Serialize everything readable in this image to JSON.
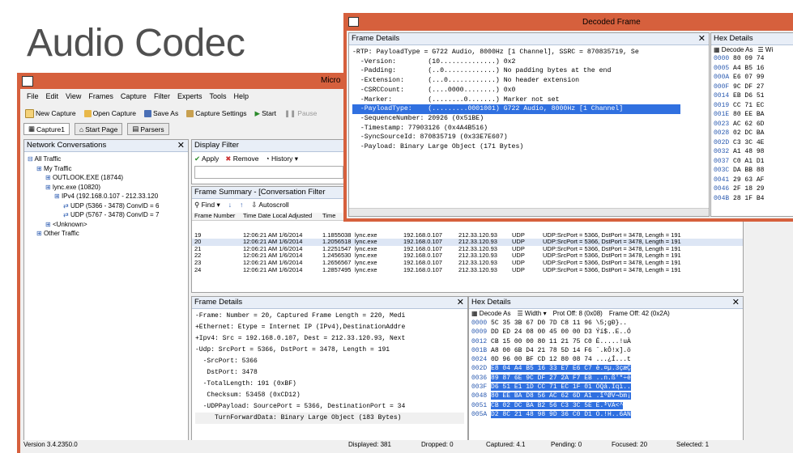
{
  "slide": {
    "title": "Audio Codec"
  },
  "app": {
    "title": "Micro",
    "menu": [
      "File",
      "Edit",
      "View",
      "Frames",
      "Capture",
      "Filter",
      "Experts",
      "Tools",
      "Help"
    ],
    "toolbar": [
      "New Capture",
      "Open Capture",
      "Save As",
      "Capture Settings",
      "Start",
      "Pause"
    ],
    "tabs": [
      "Capture1",
      "Start Page",
      "Parsers"
    ]
  },
  "network_conversations": {
    "title": "Network Conversations",
    "items": [
      {
        "label": "All Traffic",
        "indent": 0
      },
      {
        "label": "My Traffic",
        "indent": 1
      },
      {
        "label": "OUTLOOK.EXE (18744)",
        "indent": 2
      },
      {
        "label": "lync.exe (10820)",
        "indent": 2
      },
      {
        "label": "IPv4 (192.168.0.107 - 212.33.120",
        "indent": 3
      },
      {
        "label": "UDP (5366 - 3478) ConvID = 6",
        "indent": 4
      },
      {
        "label": "UDP (5767 - 3478) ConvID = 7",
        "indent": 4
      },
      {
        "label": "<Unknown>",
        "indent": 2
      },
      {
        "label": "Other Traffic",
        "indent": 1
      }
    ]
  },
  "display_filter": {
    "title": "Display Filter",
    "buttons": [
      "Apply",
      "Remove",
      "History"
    ]
  },
  "frame_summary": {
    "title": "Frame Summary - [Conversation Filter",
    "buttons": [
      "Find",
      "Autoscroll"
    ],
    "columns": [
      "Frame Number",
      "Time Date Local Adjusted",
      "Time"
    ],
    "rows": [
      [
        "19",
        "12:06:21 AM 1/6/2014",
        "1.1855038",
        "lync.exe",
        "192.168.0.107",
        "212.33.120.93",
        "UDP",
        "UDP:SrcPort = 5366, DstPort = 3478, Length = 191"
      ],
      [
        "20",
        "12:06:21 AM 1/6/2014",
        "1.2056518",
        "lync.exe",
        "192.168.0.107",
        "212.33.120.93",
        "UDP",
        "UDP:SrcPort = 5366, DstPort = 3478, Length = 191"
      ],
      [
        "21",
        "12:06:21 AM 1/6/2014",
        "1.2251547",
        "lync.exe",
        "192.168.0.107",
        "212.33.120.93",
        "UDP",
        "UDP:SrcPort = 5366, DstPort = 3478, Length = 191"
      ],
      [
        "22",
        "12:06:21 AM 1/6/2014",
        "1.2456530",
        "lync.exe",
        "192.168.0.107",
        "212.33.120.93",
        "UDP",
        "UDP:SrcPort = 5366, DstPort = 3478, Length = 191"
      ],
      [
        "23",
        "12:06:21 AM 1/6/2014",
        "1.2656567",
        "lync.exe",
        "192.168.0.107",
        "212.33.120.93",
        "UDP",
        "UDP:SrcPort = 5366, DstPort = 3478, Length = 191"
      ],
      [
        "24",
        "12:06:21 AM 1/6/2014",
        "1.2857495",
        "lync.exe",
        "192.168.0.107",
        "212.33.120.93",
        "UDP",
        "UDP:SrcPort = 5366, DstPort = 3478, Length = 191"
      ]
    ]
  },
  "frame_details": {
    "title": "Frame Details",
    "lines": [
      "-Frame: Number = 20, Captured Frame Length = 220, Medi",
      "+Ethernet: Etype = Internet IP (IPv4),DestinationAddre",
      "+Ipv4: Src = 192.168.0.107, Dest = 212.33.120.93, Next",
      "-Udp: SrcPort = 5366, DstPort = 3478, Length = 191",
      "  -SrcPort: 5366",
      "   DstPort: 3478",
      "  -TotalLength: 191 (0xBF)",
      "   Checksum: 53458 (0xCD12)",
      "  -UDPPayload: SourcePort = 5366, DestinationPort = 34",
      "     TurnForwardData: Binary Large Object (183 Bytes)"
    ]
  },
  "hex_details": {
    "title": "Hex Details",
    "buttons": [
      "Decode As",
      "Width",
      "Prot Off: 8 (0x08)",
      "Frame Off: 42 (0x2A)"
    ],
    "rows": [
      [
        "0000",
        "5C 35 3B 67 D0 7D C8 11 96",
        "\\5;gÐ}.."
      ],
      [
        "0009",
        "DD ED 24 08 00 45 00 00 D3",
        "Ýí$..E..Ó"
      ],
      [
        "0012",
        "CB 15 00 00 80 11 21 75 C0",
        "Ë.....!uÀ"
      ],
      [
        "001B",
        "A8 00 6B D4 21 78 5D 14 F6",
        "¨.kÔ!x].ö"
      ],
      [
        "0024",
        "0D 96 00 BF CD 12 80 08 74",
        "...¿Í...t"
      ],
      [
        "002D",
        "E8 04 A4 B5 16 33 E7 E6 C7",
        "è.¤µ.3çæÇ"
      ],
      [
        "0036",
        "89 87 6E 9C DF 27 2A F7 EB",
        "..n.ß'*÷ë"
      ],
      [
        "003F",
        "D6 51 E1 1D CC 71 EC 1F 01",
        "ÖQá.Ìqì.."
      ],
      [
        "0048",
        "80 EE BA D8 56 AC 62 6D A1",
        ".îºØV¬bm¡"
      ],
      [
        "0051",
        "CB 02 DC BA B2 56 C3 3C 5E",
        "Ë.ܺ²VÃ<^"
      ],
      [
        "005A",
        "D2 8C 21 48 98 9D 36 C0 D1",
        "Ò.!H..6ÀÑ"
      ]
    ]
  },
  "status_bar": {
    "version": "Version 3.4.2350.0",
    "displayed": "Displayed: 381",
    "dropped": "Dropped: 0",
    "captured": "Captured: 4.1",
    "pending": "Pending: 0",
    "focused": "Focused: 20",
    "selected": "Selected: 1"
  },
  "decoded_frame": {
    "title": "Decoded Frame",
    "frame_details_title": "Frame Details",
    "lines": [
      "-RTP: PayloadType = G722 Audio, 8000Hz [1 Channel], SSRC = 870835719, Se",
      "  -Version:        (10..............) 0x2",
      "  -Padding:        (..0.............) No padding bytes at the end",
      "  -Extension:      (...0............) No header extension",
      "  -CSRCCount:      (....0000........) 0x0",
      "  -Marker:         (........0.......) Marker not set",
      "  -PayloadType:    (.........0001001) G722 Audio, 8000Hz [1 Channel]",
      "  -SequenceNumber: 20926 (0x51BE)",
      "  -Timestamp: 77903126 (0x4A4B516)",
      "  -SyncSourceId: 870835719 (0x33E7E607)",
      "  -Payload: Binary Large Object (171 Bytes)"
    ],
    "selected_index": 6,
    "hex_title": "Hex Details",
    "hex_buttons": [
      "Decode As",
      "Wi"
    ],
    "hex_rows": [
      [
        "0000",
        "80 09 74"
      ],
      [
        "0005",
        "A4 B5 16"
      ],
      [
        "000A",
        "E6 07 99"
      ],
      [
        "000F",
        "9C DF 27"
      ],
      [
        "0014",
        "EB D6 51"
      ],
      [
        "0019",
        "CC 71 EC"
      ],
      [
        "001E",
        "80 EE BA"
      ],
      [
        "0023",
        "AC 62 6D"
      ],
      [
        "0028",
        "02 DC BA"
      ],
      [
        "002D",
        "C3 3C 4E"
      ],
      [
        "0032",
        "A1 48 98"
      ],
      [
        "0037",
        "C0 A1 D1"
      ],
      [
        "003C",
        "DA BB 88"
      ],
      [
        "0041",
        "29 63 AF"
      ],
      [
        "0046",
        "2F 18 29"
      ],
      [
        "004B",
        "28 1F B4"
      ]
    ]
  }
}
